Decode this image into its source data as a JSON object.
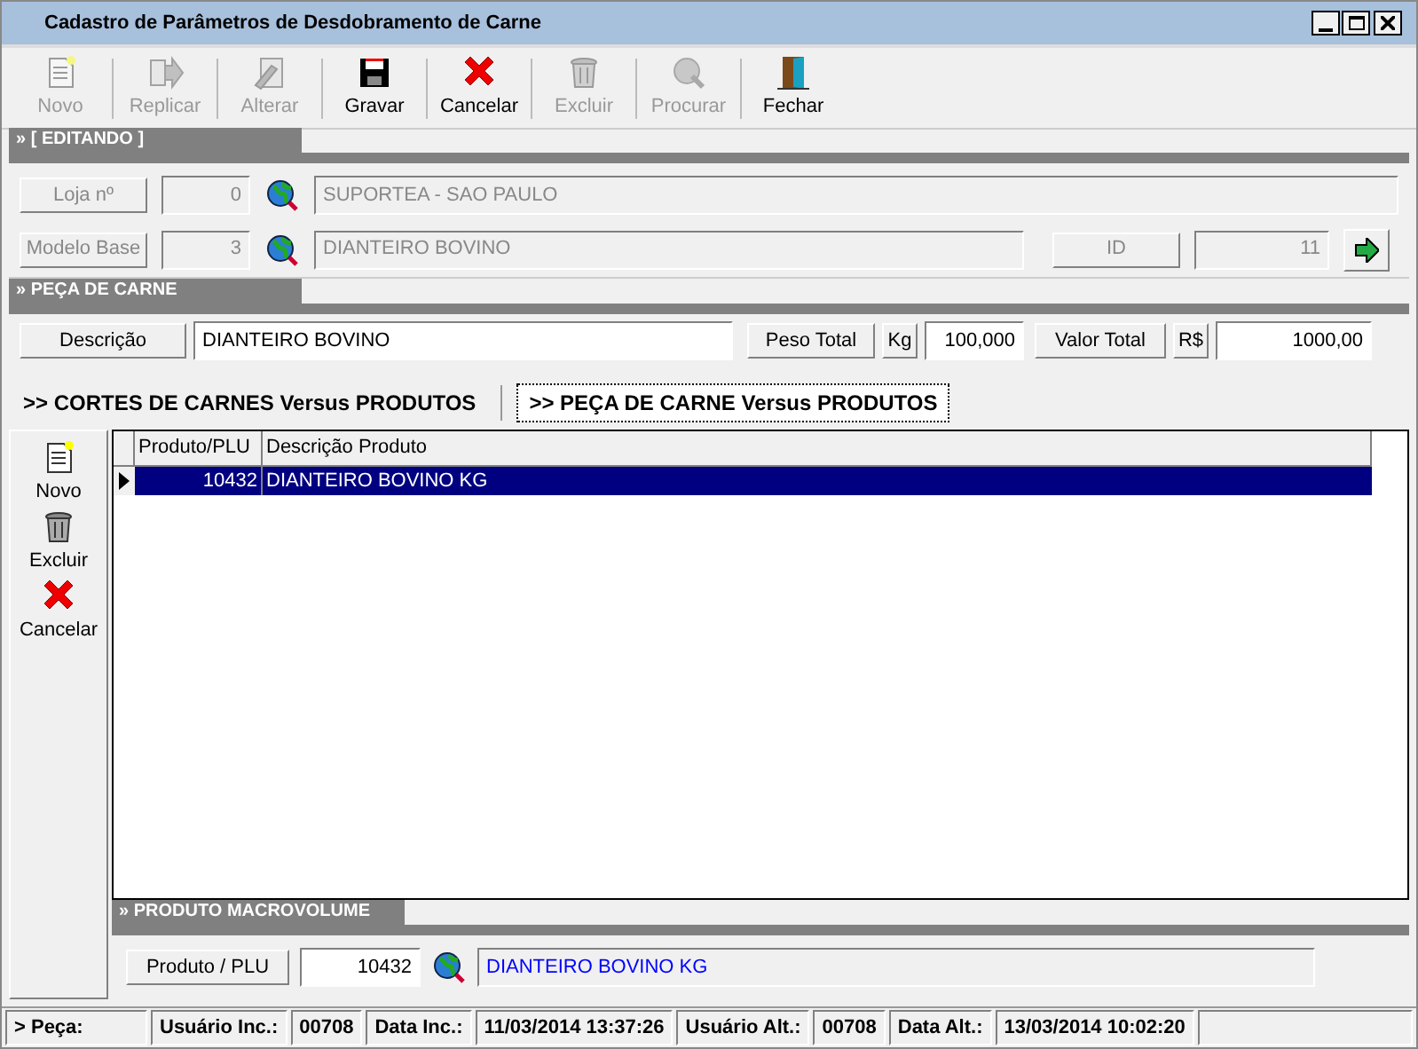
{
  "window": {
    "title": "Cadastro de Parâmetros de Desdobramento de Carne"
  },
  "toolbar": [
    {
      "label": "Novo",
      "kind": "new",
      "disabled": true
    },
    {
      "label": "Replicar",
      "kind": "replicate",
      "disabled": true
    },
    {
      "label": "Alterar",
      "kind": "edit",
      "disabled": true
    },
    {
      "label": "Gravar",
      "kind": "save",
      "disabled": false
    },
    {
      "label": "Cancelar",
      "kind": "cancel",
      "disabled": false
    },
    {
      "label": "Excluir",
      "kind": "delete",
      "disabled": true
    },
    {
      "label": "Procurar",
      "kind": "search",
      "disabled": true
    },
    {
      "label": "Fechar",
      "kind": "exit",
      "disabled": false
    }
  ],
  "editing": {
    "title": "» [ EDITANDO ]",
    "loja": {
      "label": "Loja nº",
      "code": "0",
      "name": "SUPORTEA - SAO PAULO"
    },
    "modelo": {
      "label": "Modelo Base",
      "code": "3",
      "name": "DIANTEIRO BOVINO",
      "id_label": "ID",
      "id": "11"
    }
  },
  "peca": {
    "title": "» PEÇA DE CARNE",
    "descricao_label": "Descrição",
    "descricao": "DIANTEIRO BOVINO",
    "peso_label": "Peso Total",
    "peso_unit": "Kg",
    "peso": "100,000",
    "valor_label": "Valor Total",
    "valor_unit": "R$",
    "valor": "1000,00"
  },
  "tabs": [
    {
      "label": ">> CORTES DE CARNES Versus PRODUTOS",
      "selected": false
    },
    {
      "label": ">> PEÇA DE CARNE Versus PRODUTOS",
      "selected": true
    }
  ],
  "side_actions": [
    {
      "label": "Novo",
      "kind": "new"
    },
    {
      "label": "Excluir",
      "kind": "delete"
    },
    {
      "label": "Cancelar",
      "kind": "cancel"
    }
  ],
  "table": {
    "columns": [
      "Produto/PLU",
      "Descrição Produto"
    ],
    "rows": [
      {
        "plu": "10432",
        "descricao": "DIANTEIRO BOVINO KG",
        "selected": true
      }
    ]
  },
  "macrovolume": {
    "title": "» PRODUTO MACROVOLUME",
    "label": "Produto / PLU",
    "code": "10432",
    "name": "DIANTEIRO BOVINO KG"
  },
  "status_bar": [
    "> Peça:",
    "Usuário Inc.:",
    "00708",
    "Data Inc.:",
    "11/03/2014 13:37:26",
    "Usuário Alt.:",
    "00708",
    "Data Alt.:",
    "13/03/2014 10:02:20"
  ]
}
